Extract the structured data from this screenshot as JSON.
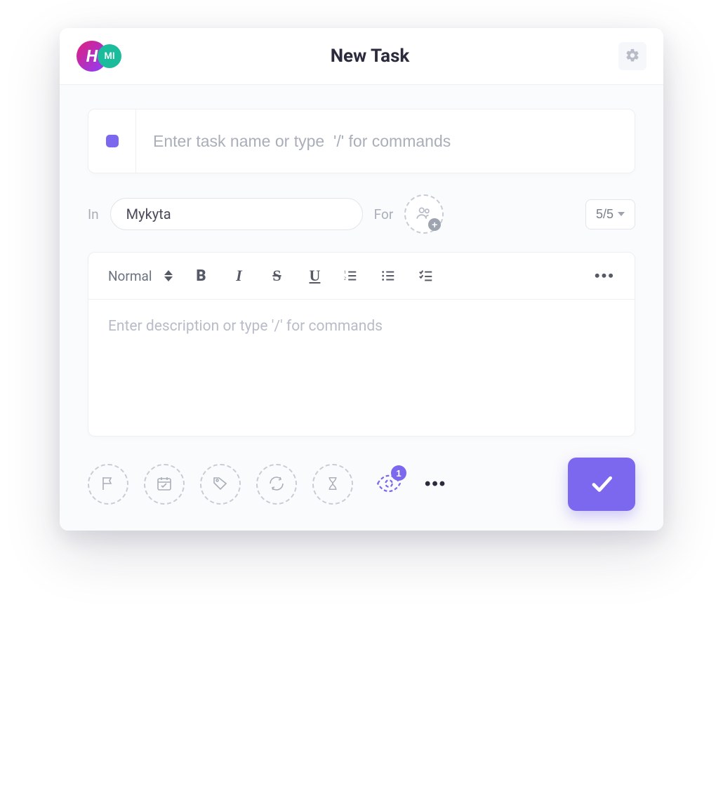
{
  "header": {
    "avatar1_text": "H",
    "avatar2_text": "MI",
    "title": "New Task"
  },
  "task_name": {
    "placeholder": "Enter task name or type  '/' for commands",
    "value": ""
  },
  "meta": {
    "in_label": "In",
    "in_value": "Mykyta",
    "for_label": "For",
    "count": "5/5"
  },
  "editor": {
    "format_label": "Normal",
    "description_placeholder": "Enter description or type '/' for commands",
    "description_value": ""
  },
  "footer": {
    "watchers_count": "1"
  },
  "icons": {
    "gear": "gear-icon",
    "people": "people-icon",
    "flag": "flag-icon",
    "calendar": "calendar-icon",
    "tag": "tag-icon",
    "repeat": "repeat-icon",
    "hourglass": "hourglass-icon",
    "eye": "eye-icon",
    "check": "check-icon"
  },
  "colors": {
    "accent": "#7b68ee",
    "teal": "#1abc9c"
  }
}
